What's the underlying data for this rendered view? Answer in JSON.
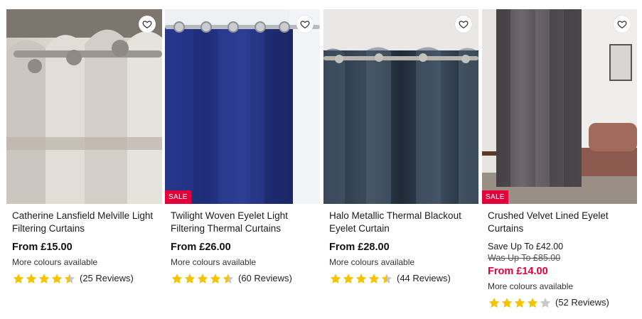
{
  "products": [
    {
      "title": "Catherine Lansfield Melville Light Filtering Curtains",
      "price": "From £15.00",
      "colours": "More colours available",
      "rating": 4.5,
      "reviews": "(25 Reviews)",
      "sale_badge": ""
    },
    {
      "title": "Twilight Woven Eyelet Light Filtering Thermal Curtains",
      "price": "From £26.00",
      "colours": "More colours available",
      "rating": 4.5,
      "reviews": "(60 Reviews)",
      "sale_badge": "SALE"
    },
    {
      "title": "Halo Metallic Thermal Blackout Eyelet Curtain",
      "price": "From £28.00",
      "colours": "More colours available",
      "rating": 4.5,
      "reviews": "(44 Reviews)",
      "sale_badge": ""
    },
    {
      "title": "Crushed Velvet Lined Eyelet Curtains",
      "save": "Save Up To £42.00",
      "was": "Was Up To £85.00",
      "price": "From £14.00",
      "colours": "More colours available",
      "rating": 4,
      "reviews": "(52 Reviews)",
      "sale_badge": "SALE"
    }
  ],
  "icons": {
    "wishlist": "heart-outline-icon",
    "rating_star": "star-icon"
  },
  "colors": {
    "sale": "#e4003b",
    "star_filled": "#f5c400",
    "star_empty": "#c8c8c8"
  }
}
